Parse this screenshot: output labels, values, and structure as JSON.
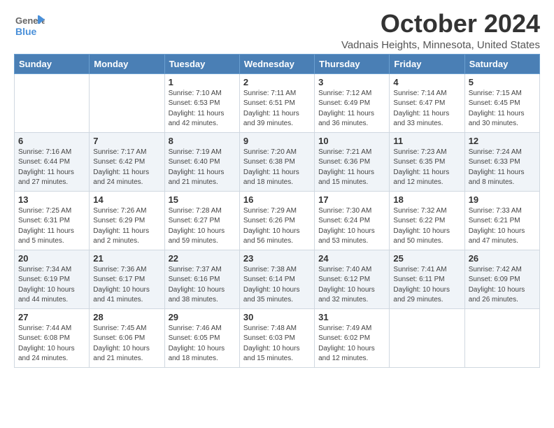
{
  "header": {
    "logo_general": "General",
    "logo_blue": "Blue",
    "month_title": "October 2024",
    "location": "Vadnais Heights, Minnesota, United States"
  },
  "weekdays": [
    "Sunday",
    "Monday",
    "Tuesday",
    "Wednesday",
    "Thursday",
    "Friday",
    "Saturday"
  ],
  "weeks": [
    [
      {
        "day": "",
        "sunrise": "",
        "sunset": "",
        "daylight": ""
      },
      {
        "day": "",
        "sunrise": "",
        "sunset": "",
        "daylight": ""
      },
      {
        "day": "1",
        "sunrise": "Sunrise: 7:10 AM",
        "sunset": "Sunset: 6:53 PM",
        "daylight": "Daylight: 11 hours and 42 minutes."
      },
      {
        "day": "2",
        "sunrise": "Sunrise: 7:11 AM",
        "sunset": "Sunset: 6:51 PM",
        "daylight": "Daylight: 11 hours and 39 minutes."
      },
      {
        "day": "3",
        "sunrise": "Sunrise: 7:12 AM",
        "sunset": "Sunset: 6:49 PM",
        "daylight": "Daylight: 11 hours and 36 minutes."
      },
      {
        "day": "4",
        "sunrise": "Sunrise: 7:14 AM",
        "sunset": "Sunset: 6:47 PM",
        "daylight": "Daylight: 11 hours and 33 minutes."
      },
      {
        "day": "5",
        "sunrise": "Sunrise: 7:15 AM",
        "sunset": "Sunset: 6:45 PM",
        "daylight": "Daylight: 11 hours and 30 minutes."
      }
    ],
    [
      {
        "day": "6",
        "sunrise": "Sunrise: 7:16 AM",
        "sunset": "Sunset: 6:44 PM",
        "daylight": "Daylight: 11 hours and 27 minutes."
      },
      {
        "day": "7",
        "sunrise": "Sunrise: 7:17 AM",
        "sunset": "Sunset: 6:42 PM",
        "daylight": "Daylight: 11 hours and 24 minutes."
      },
      {
        "day": "8",
        "sunrise": "Sunrise: 7:19 AM",
        "sunset": "Sunset: 6:40 PM",
        "daylight": "Daylight: 11 hours and 21 minutes."
      },
      {
        "day": "9",
        "sunrise": "Sunrise: 7:20 AM",
        "sunset": "Sunset: 6:38 PM",
        "daylight": "Daylight: 11 hours and 18 minutes."
      },
      {
        "day": "10",
        "sunrise": "Sunrise: 7:21 AM",
        "sunset": "Sunset: 6:36 PM",
        "daylight": "Daylight: 11 hours and 15 minutes."
      },
      {
        "day": "11",
        "sunrise": "Sunrise: 7:23 AM",
        "sunset": "Sunset: 6:35 PM",
        "daylight": "Daylight: 11 hours and 12 minutes."
      },
      {
        "day": "12",
        "sunrise": "Sunrise: 7:24 AM",
        "sunset": "Sunset: 6:33 PM",
        "daylight": "Daylight: 11 hours and 8 minutes."
      }
    ],
    [
      {
        "day": "13",
        "sunrise": "Sunrise: 7:25 AM",
        "sunset": "Sunset: 6:31 PM",
        "daylight": "Daylight: 11 hours and 5 minutes."
      },
      {
        "day": "14",
        "sunrise": "Sunrise: 7:26 AM",
        "sunset": "Sunset: 6:29 PM",
        "daylight": "Daylight: 11 hours and 2 minutes."
      },
      {
        "day": "15",
        "sunrise": "Sunrise: 7:28 AM",
        "sunset": "Sunset: 6:27 PM",
        "daylight": "Daylight: 10 hours and 59 minutes."
      },
      {
        "day": "16",
        "sunrise": "Sunrise: 7:29 AM",
        "sunset": "Sunset: 6:26 PM",
        "daylight": "Daylight: 10 hours and 56 minutes."
      },
      {
        "day": "17",
        "sunrise": "Sunrise: 7:30 AM",
        "sunset": "Sunset: 6:24 PM",
        "daylight": "Daylight: 10 hours and 53 minutes."
      },
      {
        "day": "18",
        "sunrise": "Sunrise: 7:32 AM",
        "sunset": "Sunset: 6:22 PM",
        "daylight": "Daylight: 10 hours and 50 minutes."
      },
      {
        "day": "19",
        "sunrise": "Sunrise: 7:33 AM",
        "sunset": "Sunset: 6:21 PM",
        "daylight": "Daylight: 10 hours and 47 minutes."
      }
    ],
    [
      {
        "day": "20",
        "sunrise": "Sunrise: 7:34 AM",
        "sunset": "Sunset: 6:19 PM",
        "daylight": "Daylight: 10 hours and 44 minutes."
      },
      {
        "day": "21",
        "sunrise": "Sunrise: 7:36 AM",
        "sunset": "Sunset: 6:17 PM",
        "daylight": "Daylight: 10 hours and 41 minutes."
      },
      {
        "day": "22",
        "sunrise": "Sunrise: 7:37 AM",
        "sunset": "Sunset: 6:16 PM",
        "daylight": "Daylight: 10 hours and 38 minutes."
      },
      {
        "day": "23",
        "sunrise": "Sunrise: 7:38 AM",
        "sunset": "Sunset: 6:14 PM",
        "daylight": "Daylight: 10 hours and 35 minutes."
      },
      {
        "day": "24",
        "sunrise": "Sunrise: 7:40 AM",
        "sunset": "Sunset: 6:12 PM",
        "daylight": "Daylight: 10 hours and 32 minutes."
      },
      {
        "day": "25",
        "sunrise": "Sunrise: 7:41 AM",
        "sunset": "Sunset: 6:11 PM",
        "daylight": "Daylight: 10 hours and 29 minutes."
      },
      {
        "day": "26",
        "sunrise": "Sunrise: 7:42 AM",
        "sunset": "Sunset: 6:09 PM",
        "daylight": "Daylight: 10 hours and 26 minutes."
      }
    ],
    [
      {
        "day": "27",
        "sunrise": "Sunrise: 7:44 AM",
        "sunset": "Sunset: 6:08 PM",
        "daylight": "Daylight: 10 hours and 24 minutes."
      },
      {
        "day": "28",
        "sunrise": "Sunrise: 7:45 AM",
        "sunset": "Sunset: 6:06 PM",
        "daylight": "Daylight: 10 hours and 21 minutes."
      },
      {
        "day": "29",
        "sunrise": "Sunrise: 7:46 AM",
        "sunset": "Sunset: 6:05 PM",
        "daylight": "Daylight: 10 hours and 18 minutes."
      },
      {
        "day": "30",
        "sunrise": "Sunrise: 7:48 AM",
        "sunset": "Sunset: 6:03 PM",
        "daylight": "Daylight: 10 hours and 15 minutes."
      },
      {
        "day": "31",
        "sunrise": "Sunrise: 7:49 AM",
        "sunset": "Sunset: 6:02 PM",
        "daylight": "Daylight: 10 hours and 12 minutes."
      },
      {
        "day": "",
        "sunrise": "",
        "sunset": "",
        "daylight": ""
      },
      {
        "day": "",
        "sunrise": "",
        "sunset": "",
        "daylight": ""
      }
    ]
  ]
}
